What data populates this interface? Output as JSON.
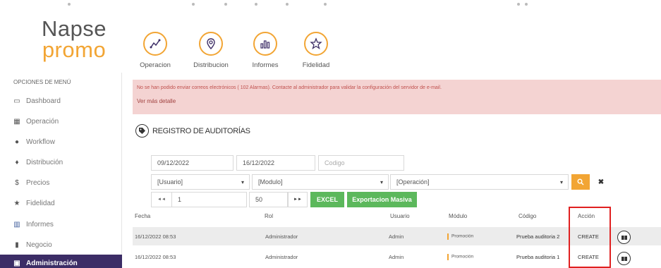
{
  "brand": {
    "line1": "Napse",
    "line2": "promo"
  },
  "nav": [
    {
      "label": "Operacion",
      "icon": "chart-line-icon"
    },
    {
      "label": "Distribucion",
      "icon": "map-pin-icon"
    },
    {
      "label": "Informes",
      "icon": "bar-chart-icon"
    },
    {
      "label": "Fidelidad",
      "icon": "star-icon"
    }
  ],
  "sidebar": {
    "heading": "OPCIONES DE MENÚ",
    "items": [
      {
        "label": "Dashboard",
        "icon": "monitor-icon"
      },
      {
        "label": "Operación",
        "icon": "grid-icon"
      },
      {
        "label": "Workflow",
        "icon": "workflow-icon"
      },
      {
        "label": "Distribución",
        "icon": "map-marker-icon"
      },
      {
        "label": "Precios",
        "icon": "dollar-icon"
      },
      {
        "label": "Fidelidad",
        "icon": "star-icon"
      },
      {
        "label": "Informes",
        "icon": "bar-chart-icon"
      },
      {
        "label": "Negocio",
        "icon": "book-icon"
      },
      {
        "label": "Administración",
        "icon": "calendar-icon",
        "active": true
      }
    ]
  },
  "alert": {
    "message": "No se han podido enviar correos electrónicos ( 102 Alarmas). Contacte al administrador para validar la configuración del servidor de e-mail.",
    "more": "Ver más detalle"
  },
  "section": {
    "title": "REGISTRO DE AUDITORÍAS"
  },
  "filters": {
    "date_from": "09/12/2022",
    "date_to": "16/12/2022",
    "codigo_placeholder": "Codigo",
    "usuario": "[Usuario]",
    "modulo": "[Modulo]",
    "operacion": "[Operación]"
  },
  "pager": {
    "first": "◄◄",
    "page": "1",
    "page_size": "50",
    "last": "►►"
  },
  "buttons": {
    "excel": "EXCEL",
    "export": "Exportacion Masiva"
  },
  "table": {
    "headers": {
      "fecha": "Fecha",
      "rol": "Rol",
      "usuario": "Usuario",
      "modulo": "Módulo",
      "codigo": "Código",
      "accion": "Acción"
    },
    "rows": [
      {
        "fecha": "16/12/2022 08:53",
        "rol": "Administrador",
        "usuario": "Admin",
        "modulo": "Promoción",
        "codigo": "Prueba auditoria 2",
        "accion": "CREATE"
      },
      {
        "fecha": "16/12/2022 08:53",
        "rol": "Administrador",
        "usuario": "Admin",
        "modulo": "Promoción",
        "codigo": "Prueba auditoria 1",
        "accion": "CREATE"
      }
    ]
  },
  "colors": {
    "accent": "#f2a534",
    "sidebar_active": "#3c2d66",
    "alert_bg": "#f4d3d2",
    "green": "#5cb85c",
    "highlight": "#e02020"
  }
}
